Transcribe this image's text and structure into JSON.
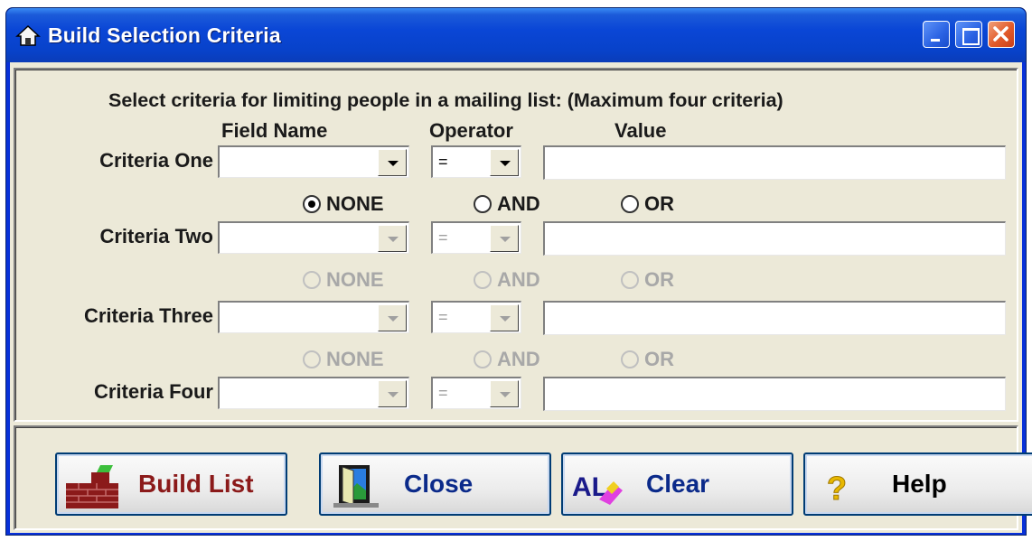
{
  "window": {
    "title": "Build Selection Criteria",
    "controls": [
      "minimize",
      "maximize",
      "close"
    ]
  },
  "instructions": "Select criteria for limiting people in a mailing list:  (Maximum four criteria)",
  "headers": {
    "field_name": "Field Name",
    "operator": "Operator",
    "value": "Value"
  },
  "criteria": [
    {
      "label": "Criteria One",
      "field": "",
      "operator": "=",
      "value": "",
      "enabled": true
    },
    {
      "label": "Criteria Two",
      "field": "",
      "operator": "=",
      "value": "",
      "enabled": false
    },
    {
      "label": "Criteria Three",
      "field": "",
      "operator": "=",
      "value": "",
      "enabled": false
    },
    {
      "label": "Criteria Four",
      "field": "",
      "operator": "=",
      "value": "",
      "enabled": false
    }
  ],
  "connectors": [
    {
      "none": "NONE",
      "and": "AND",
      "or": "OR",
      "selected": "NONE",
      "enabled": true
    },
    {
      "none": "NONE",
      "and": "AND",
      "or": "OR",
      "selected": "",
      "enabled": false
    },
    {
      "none": "NONE",
      "and": "AND",
      "or": "OR",
      "selected": "",
      "enabled": false
    }
  ],
  "buttons": {
    "build_list": "Build List",
    "close": "Close",
    "clear": "Clear",
    "help": "Help"
  },
  "colors": {
    "titlebar": "#0a46d6",
    "dialog_bg": "#ece9d8",
    "build_list_text": "#8b1a1a",
    "button_text_blue": "#0b2a8a"
  }
}
